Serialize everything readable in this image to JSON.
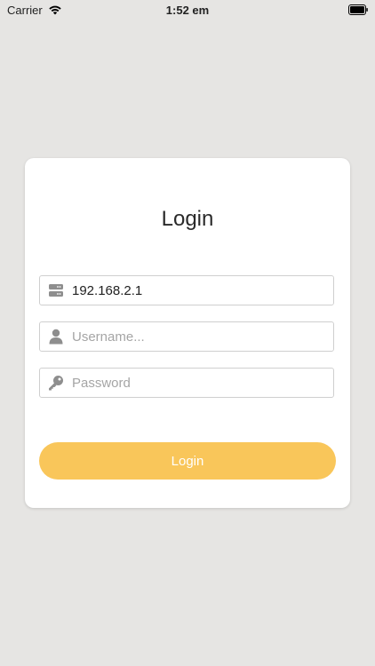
{
  "status_bar": {
    "carrier": "Carrier",
    "time": "1:52 em"
  },
  "login": {
    "title": "Login",
    "server": {
      "value": "192.168.2.1",
      "icon": "server-icon"
    },
    "username": {
      "placeholder": "Username...",
      "icon": "user-icon"
    },
    "password": {
      "placeholder": "Password",
      "icon": "key-icon"
    },
    "button_label": "Login"
  },
  "colors": {
    "background": "#e6e5e3",
    "card": "#ffffff",
    "button": "#f9c65a",
    "icon": "#8e8e8e"
  }
}
